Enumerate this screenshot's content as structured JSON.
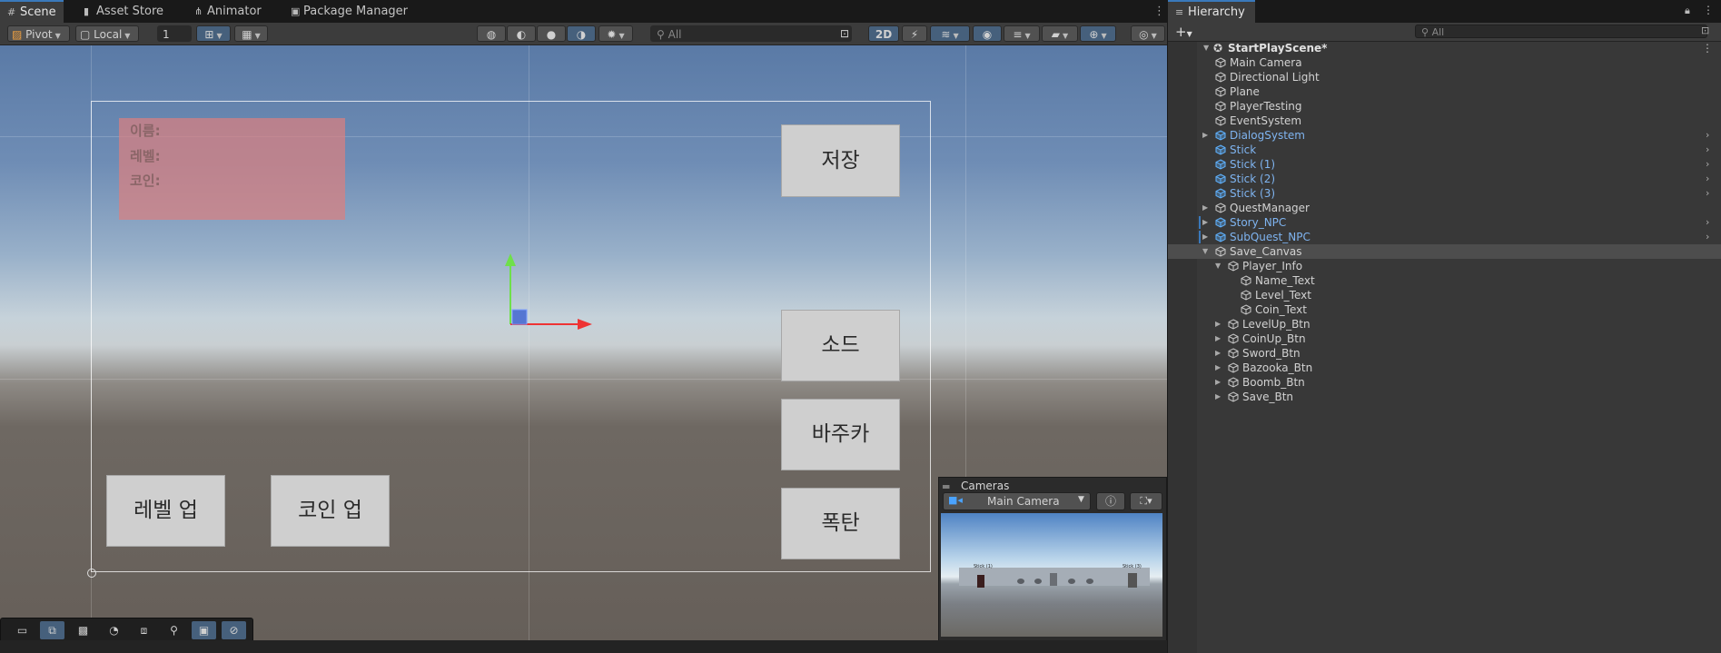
{
  "scene_tabs": [
    {
      "label": "Scene",
      "icon": "grid-icon"
    },
    {
      "label": "Asset Store",
      "icon": "store-icon"
    },
    {
      "label": "Animator",
      "icon": "animator-icon"
    },
    {
      "label": "Package Manager",
      "icon": "package-icon"
    }
  ],
  "toolbar": {
    "pivot": "Pivot",
    "local": "Local",
    "snap_value": "1",
    "search_placeholder": "All",
    "mode_2d": "2D"
  },
  "game_ui": {
    "info_labels": [
      "이름:",
      "레벨:",
      "코인:"
    ],
    "buttons": {
      "save": "저장",
      "sword": "소드",
      "bazooka": "바주카",
      "bomb": "폭탄",
      "level_up": "레벨 업",
      "coin_up": "코인 업"
    }
  },
  "cameras": {
    "title": "Cameras",
    "selected": "Main Camera",
    "preview_labels": [
      "Stick (1)",
      "Stick (3)"
    ]
  },
  "hierarchy": {
    "title": "Hierarchy",
    "search_placeholder": "All",
    "scene_name": "StartPlayScene*",
    "items": [
      {
        "label": "Main Camera",
        "depth": 1,
        "arrow": "",
        "prefab": false
      },
      {
        "label": "Directional Light",
        "depth": 1,
        "arrow": "",
        "prefab": false
      },
      {
        "label": "Plane",
        "depth": 1,
        "arrow": "",
        "prefab": false
      },
      {
        "label": "PlayerTesting",
        "depth": 1,
        "arrow": "",
        "prefab": false
      },
      {
        "label": "EventSystem",
        "depth": 1,
        "arrow": "",
        "prefab": false
      },
      {
        "label": "DialogSystem",
        "depth": 1,
        "arrow": "▶",
        "prefab": true
      },
      {
        "label": "Stick",
        "depth": 1,
        "arrow": "",
        "prefab": true
      },
      {
        "label": "Stick (1)",
        "depth": 1,
        "arrow": "",
        "prefab": true
      },
      {
        "label": "Stick (2)",
        "depth": 1,
        "arrow": "",
        "prefab": true
      },
      {
        "label": "Stick (3)",
        "depth": 1,
        "arrow": "",
        "prefab": true
      },
      {
        "label": "QuestManager",
        "depth": 1,
        "arrow": "▶",
        "prefab": false
      },
      {
        "label": "Story_NPC",
        "depth": 1,
        "arrow": "▶",
        "prefab": true
      },
      {
        "label": "SubQuest_NPC",
        "depth": 1,
        "arrow": "▶",
        "prefab": true
      },
      {
        "label": "Save_Canvas",
        "depth": 1,
        "arrow": "▼",
        "prefab": false,
        "selected": true
      },
      {
        "label": "Player_Info",
        "depth": 2,
        "arrow": "▼",
        "prefab": false
      },
      {
        "label": "Name_Text",
        "depth": 3,
        "arrow": "",
        "prefab": false
      },
      {
        "label": "Level_Text",
        "depth": 3,
        "arrow": "",
        "prefab": false
      },
      {
        "label": "Coin_Text",
        "depth": 3,
        "arrow": "",
        "prefab": false
      },
      {
        "label": "LevelUp_Btn",
        "depth": 2,
        "arrow": "▶",
        "prefab": false
      },
      {
        "label": "CoinUp_Btn",
        "depth": 2,
        "arrow": "▶",
        "prefab": false
      },
      {
        "label": "Sword_Btn",
        "depth": 2,
        "arrow": "▶",
        "prefab": false
      },
      {
        "label": "Bazooka_Btn",
        "depth": 2,
        "arrow": "▶",
        "prefab": false
      },
      {
        "label": "Boomb_Btn",
        "depth": 2,
        "arrow": "▶",
        "prefab": false
      },
      {
        "label": "Save_Btn",
        "depth": 2,
        "arrow": "▶",
        "prefab": false
      }
    ]
  },
  "colors": {
    "accent": "#3a79bb",
    "prefab_text": "#7fb4f0",
    "normal_text": "#d2d2d2",
    "selected_row": "#4d4d4d"
  }
}
